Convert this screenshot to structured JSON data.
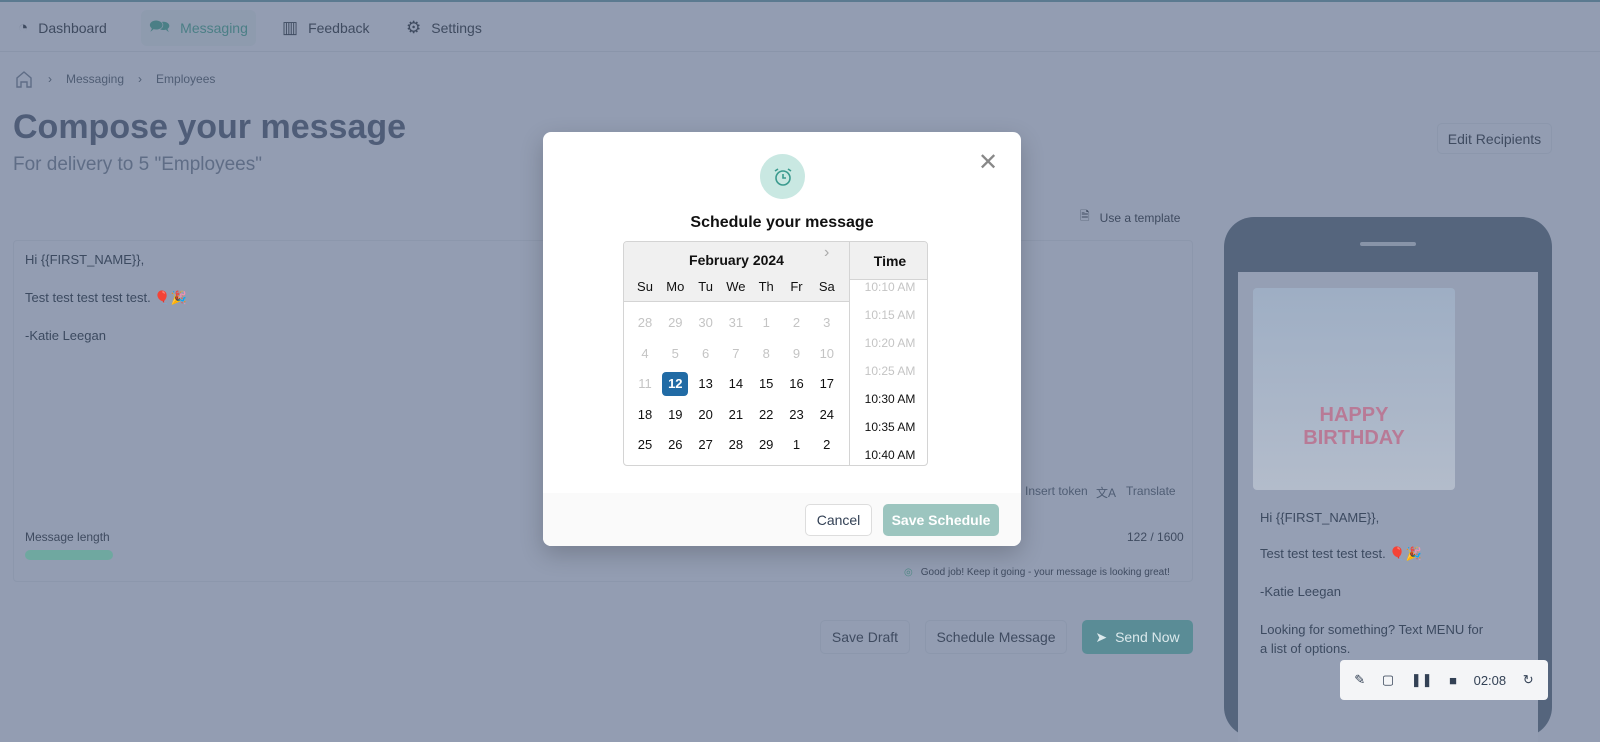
{
  "nav": [
    {
      "label": "Dashboard",
      "icon": "pie-chart-icon"
    },
    {
      "label": "Messaging",
      "icon": "chat-icon",
      "active": true
    },
    {
      "label": "Feedback",
      "icon": "bar-chart-icon"
    },
    {
      "label": "Settings",
      "icon": "gear-icon"
    }
  ],
  "breadcrumb": [
    "Messaging",
    "Employees"
  ],
  "page": {
    "title": "Compose your message",
    "subtitle": "For delivery to 5 \"Employees\"",
    "edit_recipients": "Edit Recipients",
    "use_template": "Use a template"
  },
  "compose": {
    "lines": [
      "Hi {{FIRST_NAME}},",
      "Test test test test test. 🎈🎉",
      "-Katie Leegan"
    ],
    "insert_token": "Insert token",
    "translate": "Translate",
    "length_label": "Message length",
    "count": "122 / 1600",
    "progress": 0.076,
    "feedback": "Good job! Keep it going - your message is looking great!"
  },
  "actions": {
    "save_draft": "Save Draft",
    "schedule": "Schedule Message",
    "send": "Send Now"
  },
  "preview": {
    "lines": [
      "Hi {{FIRST_NAME}},",
      "Test test test test test. 🎈🎉",
      "-Katie Leegan",
      "Looking for something? Text MENU for a list of options."
    ],
    "image_text": "HAPPY BIRTHDAY"
  },
  "modal": {
    "title": "Schedule your message",
    "month": "February 2024",
    "time_header": "Time",
    "cancel": "Cancel",
    "save": "Save Schedule",
    "dows": [
      "Su",
      "Mo",
      "Tu",
      "We",
      "Th",
      "Fr",
      "Sa"
    ],
    "weeks": [
      [
        [
          "28",
          1
        ],
        [
          "29",
          1
        ],
        [
          "30",
          1
        ],
        [
          "31",
          1
        ],
        [
          "1",
          1
        ],
        [
          "2",
          1
        ],
        [
          "3",
          1
        ]
      ],
      [
        [
          "4",
          1
        ],
        [
          "5",
          1
        ],
        [
          "6",
          1
        ],
        [
          "7",
          1
        ],
        [
          "8",
          1
        ],
        [
          "9",
          1
        ],
        [
          "10",
          1
        ]
      ],
      [
        [
          "11",
          1
        ],
        [
          "12",
          2
        ],
        [
          "13",
          0
        ],
        [
          "14",
          0
        ],
        [
          "15",
          0
        ],
        [
          "16",
          0
        ],
        [
          "17",
          0
        ]
      ],
      [
        [
          "18",
          0
        ],
        [
          "19",
          0
        ],
        [
          "20",
          0
        ],
        [
          "21",
          0
        ],
        [
          "22",
          0
        ],
        [
          "23",
          0
        ],
        [
          "24",
          0
        ]
      ],
      [
        [
          "25",
          0
        ],
        [
          "26",
          0
        ],
        [
          "27",
          0
        ],
        [
          "28",
          0
        ],
        [
          "29",
          0
        ],
        [
          "1",
          0
        ],
        [
          "2",
          0
        ]
      ]
    ],
    "selected_date": "12",
    "times": [
      [
        "10:10 AM",
        1
      ],
      [
        "10:15 AM",
        1
      ],
      [
        "10:20 AM",
        1
      ],
      [
        "10:25 AM",
        1
      ],
      [
        "10:30 AM",
        0
      ],
      [
        "10:35 AM",
        0
      ],
      [
        "10:40 AM",
        0
      ]
    ]
  },
  "recorder": {
    "time": "02:08"
  },
  "colors": {
    "accent": "#4a9a94",
    "selected": "#216ba5",
    "save_button": "#9cc5bf"
  }
}
